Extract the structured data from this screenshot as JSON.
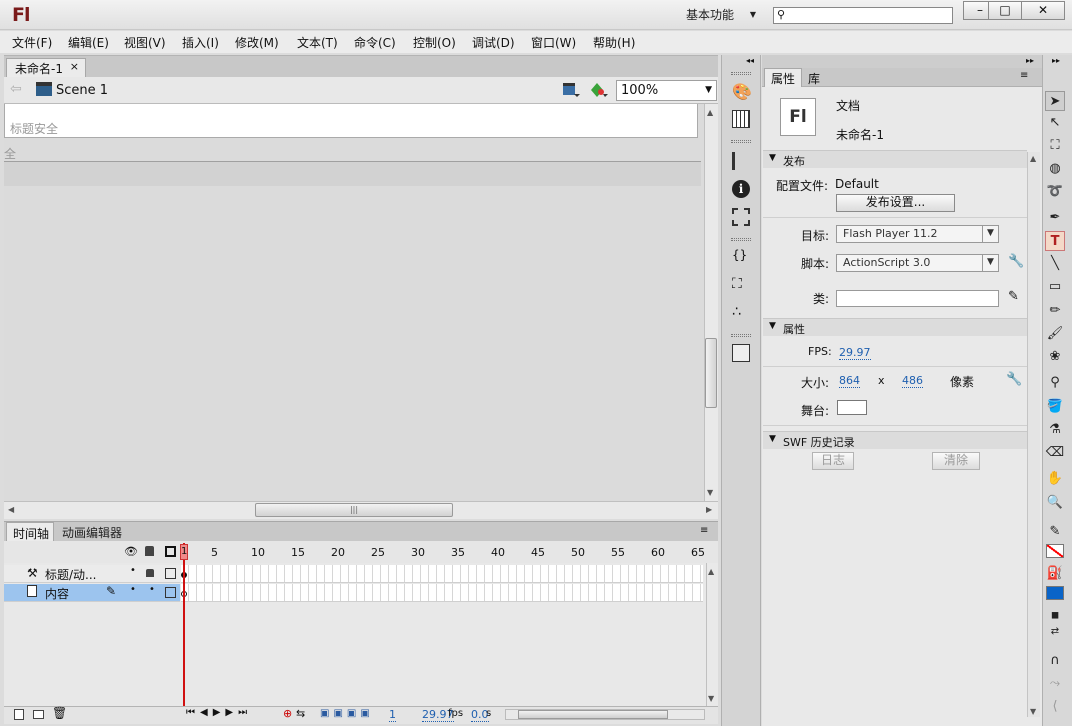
{
  "app": {
    "logo": "Fl",
    "workspace": "基本功能",
    "search_placeholder": ""
  },
  "window_buttons": {
    "minimize": "–",
    "maximize": "□",
    "close": "✕"
  },
  "menu": [
    "文件(F)",
    "编辑(E)",
    "视图(V)",
    "插入(I)",
    "修改(M)",
    "文本(T)",
    "命令(C)",
    "控制(O)",
    "调试(D)",
    "窗口(W)",
    "帮助(H)"
  ],
  "document": {
    "tab_title": "未命名-1",
    "close_glyph": "×"
  },
  "scene": {
    "label": "Scene 1",
    "zoom": "100%"
  },
  "stage": {
    "title_safe": "标题安全",
    "action_safe": "全"
  },
  "timeline": {
    "tabs": [
      "时间轴",
      "动画编辑器"
    ],
    "frame_numbers": [
      "1",
      "5",
      "10",
      "15",
      "20",
      "25",
      "30",
      "35",
      "40",
      "45",
      "50",
      "55",
      "60",
      "65"
    ],
    "layers": [
      {
        "name": "标题/动...",
        "selected": false,
        "color": "#22cc22"
      },
      {
        "name": "内容",
        "selected": true,
        "color": "#ff8800"
      }
    ],
    "footer": {
      "current_frame": "1",
      "fps": "29.97",
      "fps_unit": "fps",
      "time": "0.0",
      "time_unit": "s"
    }
  },
  "properties": {
    "tabs": [
      "属性",
      "库"
    ],
    "doc_icon": "Fl",
    "doc_type": "文档",
    "doc_name": "未命名-1",
    "publish": {
      "section": "发布",
      "profile_label": "配置文件:",
      "profile_value": "Default",
      "settings_button": "发布设置...",
      "target_label": "目标:",
      "target_value": "Flash Player 11.2",
      "script_label": "脚本:",
      "script_value": "ActionScript 3.0",
      "class_label": "类:",
      "class_value": ""
    },
    "props": {
      "section": "属性",
      "fps_label": "FPS:",
      "fps_value": "29.97",
      "size_label": "大小:",
      "width": "864",
      "x_sep": "x",
      "height": "486",
      "unit": "像素",
      "stage_label": "舞台:",
      "stage_color": "#ffffff"
    },
    "swf_history": {
      "section": "SWF 历史记录",
      "log_button": "日志",
      "clear_button": "清除"
    }
  },
  "colors": {
    "stroke_color": "#ff0000",
    "fill_color": "#0a64c8",
    "playhead": "#d01010",
    "selected_layer": "#9cc4ee"
  }
}
